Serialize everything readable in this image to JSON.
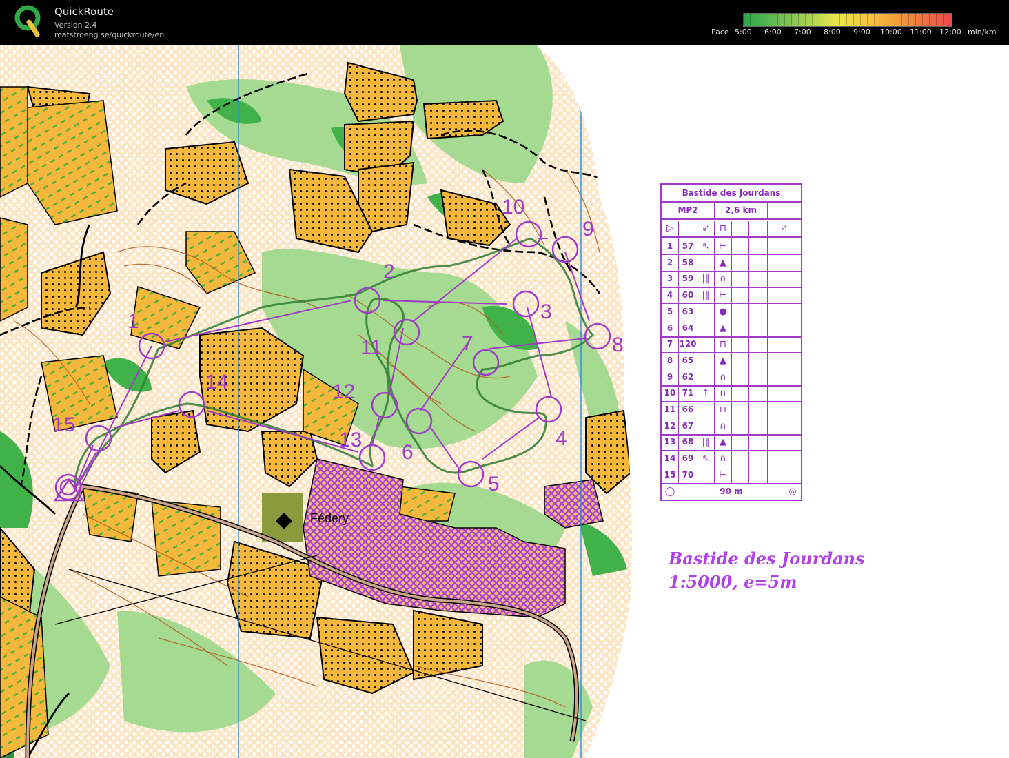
{
  "app": {
    "name": "QuickRoute",
    "version": "Version 2.4",
    "url": "matstroeng.se/quickroute/en"
  },
  "pace_legend": {
    "label": "Pace",
    "ticks": [
      "5:00",
      "6:00",
      "7:00",
      "8:00",
      "9:00",
      "10:00",
      "11:00",
      "12:00"
    ],
    "unit": "min/km",
    "colors": [
      "#2aa84a",
      "#a6d050",
      "#e8e74a",
      "#f7c640",
      "#f39a3a",
      "#ef4a4a"
    ]
  },
  "map": {
    "place_label": "Fédery",
    "title": "Bastide des Jourdans",
    "scale_line": "1:5000, e=5m",
    "controls": [
      "1",
      "2",
      "3",
      "4",
      "5",
      "6",
      "7",
      "8",
      "9",
      "10",
      "11",
      "12",
      "13",
      "14",
      "15"
    ],
    "course_color": "#a23ac9",
    "route_color": "#2e7d32"
  },
  "description": {
    "event": "Bastide des Jourdans",
    "class": "MP2",
    "length": "2,6 km",
    "finish_distance": "90 m",
    "controls": [
      {
        "num": "1",
        "code": "57",
        "dir": "↖",
        "feature": "⊢"
      },
      {
        "num": "2",
        "code": "58",
        "dir": "",
        "feature": "▲"
      },
      {
        "num": "3",
        "code": "59",
        "dir": "|‖",
        "feature": "∩"
      },
      {
        "num": "4",
        "code": "60",
        "dir": "|‖",
        "feature": "⊢"
      },
      {
        "num": "5",
        "code": "63",
        "dir": "",
        "feature": "●"
      },
      {
        "num": "6",
        "code": "64",
        "dir": "",
        "feature": "▲"
      },
      {
        "num": "7",
        "code": "120",
        "dir": "",
        "feature": "⊓"
      },
      {
        "num": "8",
        "code": "65",
        "dir": "",
        "feature": "▲"
      },
      {
        "num": "9",
        "code": "62",
        "dir": "",
        "feature": "∩"
      },
      {
        "num": "10",
        "code": "71",
        "dir": "↑",
        "feature": "∩"
      },
      {
        "num": "11",
        "code": "66",
        "dir": "",
        "feature": "⊓"
      },
      {
        "num": "12",
        "code": "67",
        "dir": "",
        "feature": "∩"
      },
      {
        "num": "13",
        "code": "68",
        "dir": "|‖",
        "feature": "▲"
      },
      {
        "num": "14",
        "code": "69",
        "dir": "↖",
        "feature": "∩"
      },
      {
        "num": "15",
        "code": "70",
        "dir": "",
        "feature": "⊢"
      }
    ]
  }
}
